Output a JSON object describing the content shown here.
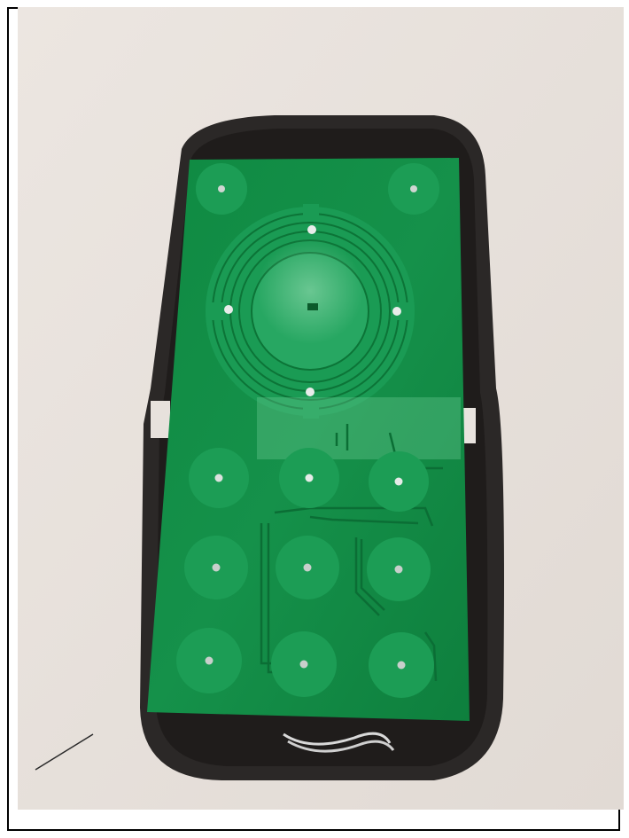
{
  "image": {
    "subject": "pcb-keypad-inside-remote-housing",
    "colors": {
      "background": "#e6e0db",
      "housing": "#2a2726",
      "pcb": "#128a44",
      "pad": "#1b9a52",
      "trace": "#0d7a3a",
      "via": "#c9c9c9"
    }
  }
}
